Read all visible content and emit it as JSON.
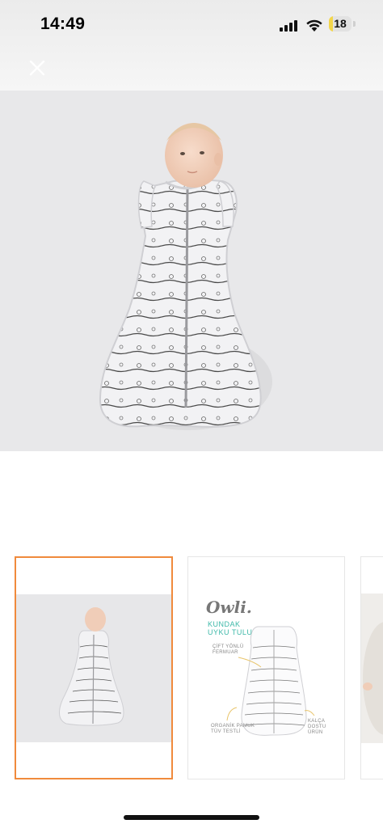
{
  "status": {
    "time": "14:49",
    "battery": "18",
    "battery_level": 0.18
  },
  "viewer": {
    "close_icon": "close-icon"
  },
  "thumbnails": [
    {
      "selected": true
    },
    {
      "selected": false,
      "logo": "Owli.",
      "title_line1": "KUNDAK",
      "title_line2": "UYKU TULUMU",
      "annot1_line1": "ÇİFT YÖNLÜ",
      "annot1_line2": "FERMUAR",
      "annot2_line1": "ORGANİK PAMUK",
      "annot2_line2": "TÜV TESTLİ",
      "annot3_line1": "KALÇA DOSTU",
      "annot3_line2": "ÜRÜN"
    },
    {
      "selected": false
    }
  ],
  "colors": {
    "selected_border": "#f08a3c",
    "accent_teal": "#3cb8a8"
  }
}
